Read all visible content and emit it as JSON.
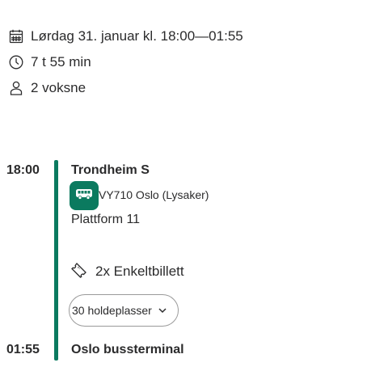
{
  "trip": {
    "date_time": "Lørdag 31. januar kl. 18:00—01:55",
    "duration": "7 t 55 min",
    "travellers": "2 voksne"
  },
  "journey": {
    "departure_time": "18:00",
    "departure_stop": "Trondheim S",
    "line": "VY710 Oslo (Lysaker)",
    "platform": "Plattform 11",
    "ticket": "2x Enkeltbillett",
    "stops_button": "30 holdeplasser",
    "arrival_time": "01:55",
    "arrival_stop": "Oslo bussterminal"
  },
  "icons": {
    "calendar": "calendar-icon",
    "clock": "clock-icon",
    "person": "person-icon",
    "bus": "bus-icon",
    "ticket": "ticket-icon",
    "chevron": "chevron-down-icon"
  },
  "colors": {
    "accent": "#0b7a5f",
    "text": "#2b2b2c"
  }
}
